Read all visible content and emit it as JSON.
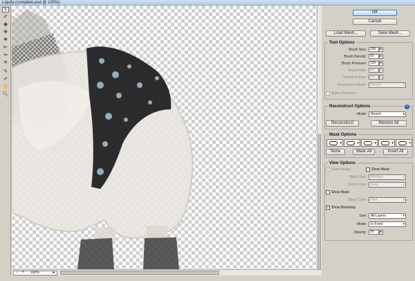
{
  "window": {
    "title": "Liquify (complete.psd @ 100%)"
  },
  "tools": [
    "forward-warp",
    "reconstruct",
    "twirl",
    "pucker",
    "bloat",
    "push-left",
    "mirror",
    "turbulence",
    "freeze-mask",
    "thaw-mask",
    "hand",
    "zoom"
  ],
  "status": {
    "zoom": "100%"
  },
  "buttons": {
    "ok": "OK",
    "cancel": "Cancel",
    "load_mesh": "Load Mesh...",
    "save_mesh": "Save Mesh..."
  },
  "tool_options": {
    "title": "Tool Options",
    "brush_size_label": "Brush Size:",
    "brush_size": "200",
    "brush_density_label": "Brush Density:",
    "brush_density": "50",
    "brush_pressure_label": "Brush Pressure:",
    "brush_pressure": "100",
    "brush_rate_label": "Brush Rate:",
    "brush_rate": "80",
    "turbulent_jitter_label": "Turbulent Jitter:",
    "turbulent_jitter": "50",
    "reconstruct_mode_label": "Reconstruct Mode:",
    "reconstruct_mode": "Revert",
    "stylus_pressure": "Stylus Pressure"
  },
  "reconstruct_options": {
    "title": "Reconstruct Options",
    "mode_label": "Mode:",
    "mode": "Revert",
    "reconstruct": "Reconstruct",
    "restore_all": "Restore All"
  },
  "mask_options": {
    "title": "Mask Options",
    "none": "None",
    "mask_all": "Mask All",
    "invert_all": "Invert All"
  },
  "view_options": {
    "title": "View Options",
    "show_image": "Show Image",
    "show_mesh": "Show Mesh",
    "mesh_size_label": "Mesh Size:",
    "mesh_size": "Medium",
    "mesh_color_label": "Mesh Color:",
    "mesh_color": "Gray",
    "show_mask": "Show Mask",
    "mask_color_label": "Mask Color:",
    "mask_color": "Red",
    "show_backdrop": "Show Backdrop",
    "use_label": "Use:",
    "use": "All Layers",
    "mode_label": "Mode:",
    "mode": "In Front",
    "opacity_label": "Opacity:",
    "opacity": "50"
  }
}
